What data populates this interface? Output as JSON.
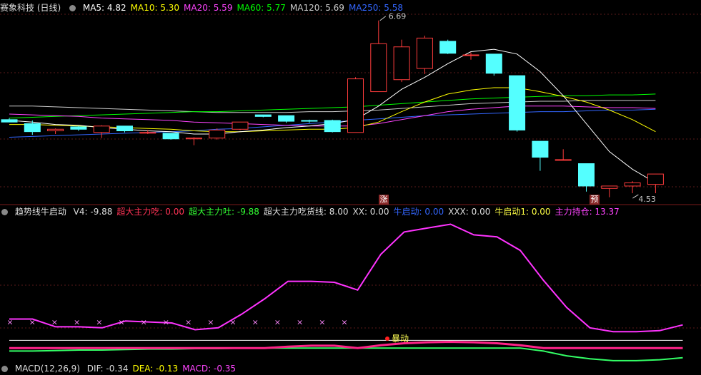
{
  "main_header": {
    "stock_title": "赛象科技 (日线)",
    "ma_items": [
      {
        "label": "MA5: 4.82",
        "color": "#ffffff"
      },
      {
        "label": "MA10: 5.30",
        "color": "#ffff00"
      },
      {
        "label": "MA20: 5.59",
        "color": "#ff44ff"
      },
      {
        "label": "MA60: 5.77",
        "color": "#00ff00"
      },
      {
        "label": "MA120: 5.69",
        "color": "#cccccc"
      },
      {
        "label": "MA250: 5.58",
        "color": "#3366ff"
      }
    ]
  },
  "price_annotations": {
    "high_label": "6.69",
    "low_label": "4.53"
  },
  "markers": {
    "zhang": "涨",
    "yu": "预"
  },
  "indicator_header": {
    "title": "趋势线牛启动",
    "items": [
      {
        "label": "V4: -9.88",
        "color": "#dddddd"
      },
      {
        "label": "超大主力吃: 0.00",
        "color": "#ff3355"
      },
      {
        "label": "超大主力吐: -9.88",
        "color": "#33ff33"
      },
      {
        "label": "超大主力吃货线: 8.00",
        "color": "#dddddd"
      },
      {
        "label": "XX: 0.00",
        "color": "#dddddd"
      },
      {
        "label": "牛启动: 0.00",
        "color": "#3366ff"
      },
      {
        "label": "XXX: 0.00",
        "color": "#dddddd"
      },
      {
        "label": "牛启动1: 0.00",
        "color": "#ffff44"
      },
      {
        "label": "主力持仓: 13.37",
        "color": "#ff44ff"
      }
    ],
    "explosion_label": "暴动"
  },
  "macd_header": {
    "title": "MACD(12,26,9)",
    "items": [
      {
        "label": "DIF: -0.34",
        "color": "#dddddd"
      },
      {
        "label": "DEA: -0.13",
        "color": "#ffff00"
      },
      {
        "label": "MACD: -0.35",
        "color": "#ff44ff"
      }
    ]
  },
  "chart_data": {
    "type": "candlestick",
    "candles": [
      {
        "o": 5.45,
        "h": 5.47,
        "l": 5.42,
        "c": 5.42
      },
      {
        "o": 5.4,
        "h": 5.44,
        "l": 5.26,
        "c": 5.3
      },
      {
        "o": 5.31,
        "h": 5.34,
        "l": 5.27,
        "c": 5.33
      },
      {
        "o": 5.36,
        "h": 5.37,
        "l": 5.31,
        "c": 5.33
      },
      {
        "o": 5.29,
        "h": 5.38,
        "l": 5.22,
        "c": 5.37
      },
      {
        "o": 5.37,
        "h": 5.37,
        "l": 5.29,
        "c": 5.31
      },
      {
        "o": 5.29,
        "h": 5.32,
        "l": 5.27,
        "c": 5.29
      },
      {
        "o": 5.28,
        "h": 5.28,
        "l": 5.2,
        "c": 5.21
      },
      {
        "o": 5.21,
        "h": 5.23,
        "l": 5.13,
        "c": 5.22
      },
      {
        "o": 5.22,
        "h": 5.34,
        "l": 5.2,
        "c": 5.32
      },
      {
        "o": 5.33,
        "h": 5.42,
        "l": 5.32,
        "c": 5.42
      },
      {
        "o": 5.51,
        "h": 5.51,
        "l": 5.48,
        "c": 5.49
      },
      {
        "o": 5.5,
        "h": 5.5,
        "l": 5.41,
        "c": 5.43
      },
      {
        "o": 5.44,
        "h": 5.45,
        "l": 5.41,
        "c": 5.43
      },
      {
        "o": 5.44,
        "h": 5.45,
        "l": 5.29,
        "c": 5.3
      },
      {
        "o": 5.29,
        "h": 5.98,
        "l": 5.29,
        "c": 5.96
      },
      {
        "o": 5.8,
        "h": 6.69,
        "l": 5.8,
        "c": 6.4
      },
      {
        "o": 5.95,
        "h": 6.45,
        "l": 5.92,
        "c": 6.36
      },
      {
        "o": 6.09,
        "h": 6.5,
        "l": 6.02,
        "c": 6.47
      },
      {
        "o": 6.43,
        "h": 6.45,
        "l": 6.27,
        "c": 6.28
      },
      {
        "o": 6.26,
        "h": 6.29,
        "l": 6.2,
        "c": 6.26
      },
      {
        "o": 6.27,
        "h": 6.27,
        "l": 6.0,
        "c": 6.03
      },
      {
        "o": 6.0,
        "h": 6.0,
        "l": 5.3,
        "c": 5.32
      },
      {
        "o": 5.18,
        "h": 5.18,
        "l": 4.81,
        "c": 4.98
      },
      {
        "o": 4.95,
        "h": 5.08,
        "l": 4.94,
        "c": 4.95
      },
      {
        "o": 4.9,
        "h": 4.9,
        "l": 4.55,
        "c": 4.62
      },
      {
        "o": 4.59,
        "h": 4.62,
        "l": 4.48,
        "c": 4.62
      },
      {
        "o": 4.62,
        "h": 4.68,
        "l": 4.53,
        "c": 4.66
      },
      {
        "o": 4.64,
        "h": 4.76,
        "l": 4.53,
        "c": 4.77
      }
    ],
    "ma5": [
      5.44,
      5.42,
      5.39,
      5.38,
      5.35,
      5.33,
      5.31,
      5.3,
      5.27,
      5.27,
      5.3,
      5.32,
      5.35,
      5.37,
      5.4,
      5.45,
      5.62,
      5.83,
      5.98,
      6.15,
      6.3,
      6.33,
      6.27,
      6.05,
      5.75,
      5.4,
      5.05,
      4.83,
      4.66
    ],
    "ma10": [
      5.39,
      5.39,
      5.38,
      5.37,
      5.36,
      5.35,
      5.34,
      5.33,
      5.31,
      5.3,
      5.3,
      5.31,
      5.32,
      5.33,
      5.33,
      5.35,
      5.42,
      5.55,
      5.67,
      5.77,
      5.82,
      5.85,
      5.85,
      5.8,
      5.74,
      5.67,
      5.57,
      5.45,
      5.3
    ],
    "ma20": [
      5.52,
      5.51,
      5.5,
      5.49,
      5.47,
      5.46,
      5.45,
      5.44,
      5.42,
      5.41,
      5.4,
      5.39,
      5.38,
      5.37,
      5.37,
      5.37,
      5.4,
      5.45,
      5.5,
      5.55,
      5.58,
      5.6,
      5.62,
      5.62,
      5.62,
      5.61,
      5.6,
      5.6,
      5.59
    ],
    "ma60": [
      5.47,
      5.48,
      5.49,
      5.5,
      5.51,
      5.52,
      5.53,
      5.54,
      5.55,
      5.55,
      5.56,
      5.57,
      5.58,
      5.59,
      5.6,
      5.61,
      5.63,
      5.65,
      5.67,
      5.69,
      5.71,
      5.72,
      5.73,
      5.74,
      5.75,
      5.75,
      5.76,
      5.76,
      5.77
    ],
    "ma120": [
      5.62,
      5.62,
      5.61,
      5.6,
      5.59,
      5.58,
      5.57,
      5.56,
      5.55,
      5.54,
      5.54,
      5.54,
      5.54,
      5.55,
      5.55,
      5.56,
      5.57,
      5.59,
      5.61,
      5.63,
      5.65,
      5.66,
      5.67,
      5.68,
      5.68,
      5.69,
      5.69,
      5.69,
      5.69
    ],
    "ma250": [
      5.23,
      5.24,
      5.25,
      5.26,
      5.27,
      5.28,
      5.29,
      5.3,
      5.31,
      5.33,
      5.34,
      5.36,
      5.38,
      5.4,
      5.42,
      5.44,
      5.46,
      5.48,
      5.5,
      5.51,
      5.52,
      5.53,
      5.54,
      5.55,
      5.55,
      5.56,
      5.57,
      5.57,
      5.58
    ],
    "ylim": [
      4.45,
      6.75
    ],
    "indicator": {
      "main_holding": [
        30,
        30,
        22,
        22,
        21,
        28,
        27,
        26,
        19,
        21,
        35,
        51,
        69,
        69,
        68,
        60,
        97,
        120,
        124,
        128,
        117,
        115,
        101,
        70,
        42,
        21,
        17,
        17,
        18,
        24
      ],
      "eat_line": [
        8,
        8,
        8,
        8,
        8,
        8,
        8,
        8,
        8,
        8,
        8,
        8,
        8,
        8,
        8,
        8,
        8,
        8,
        8,
        8,
        8,
        8,
        8,
        8,
        8,
        8,
        8,
        8,
        8,
        8
      ],
      "eat": [
        0,
        0,
        0,
        0,
        0,
        0,
        0,
        0,
        0,
        0,
        0,
        0,
        1.5,
        2.5,
        2.5,
        0,
        3,
        5,
        6,
        6.5,
        6,
        5,
        3,
        0,
        0,
        0,
        0,
        0,
        0,
        0
      ],
      "spit": [
        -3,
        -3,
        -2.5,
        -2,
        -2,
        -1.5,
        -1,
        -1,
        -0.5,
        -0.5,
        0,
        0,
        0,
        0,
        0,
        0,
        0,
        0,
        0,
        0,
        0,
        0,
        0,
        -3,
        -8,
        -11,
        -13,
        -13,
        -12,
        -9.88
      ],
      "x_markers": [
        0,
        2,
        4,
        6,
        8,
        10,
        12,
        14,
        16,
        18,
        20,
        22,
        24,
        26,
        28,
        30
      ],
      "ylim": [
        -16,
        135
      ]
    }
  }
}
